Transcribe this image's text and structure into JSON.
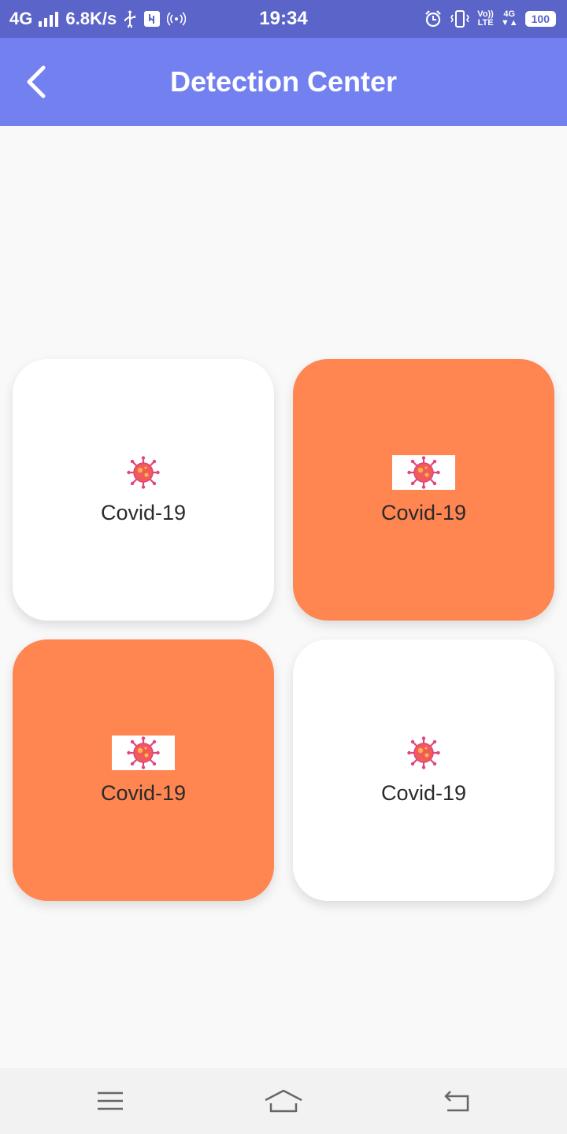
{
  "status_bar": {
    "network": "4G",
    "speed": "6.8K/s",
    "time": "19:34",
    "volte_top": "Vo))",
    "volte_bottom": "LTE",
    "lte_top": "4G",
    "battery": "100"
  },
  "app_bar": {
    "title": "Detection Center",
    "background": "#7280f0"
  },
  "cards": [
    {
      "label": "Covid-19",
      "icon": "virus-icon",
      "highlighted": false
    },
    {
      "label": "Covid-19",
      "icon": "virus-icon",
      "highlighted": true
    },
    {
      "label": "Covid-19",
      "icon": "virus-icon",
      "highlighted": true
    },
    {
      "label": "Covid-19",
      "icon": "virus-icon",
      "highlighted": false
    }
  ],
  "colors": {
    "highlight": "#ff8551",
    "card": "#ffffff",
    "status_bar": "#5b64c9"
  },
  "nav_bar": {
    "buttons": [
      "menu-icon",
      "home-icon",
      "back-icon"
    ]
  }
}
